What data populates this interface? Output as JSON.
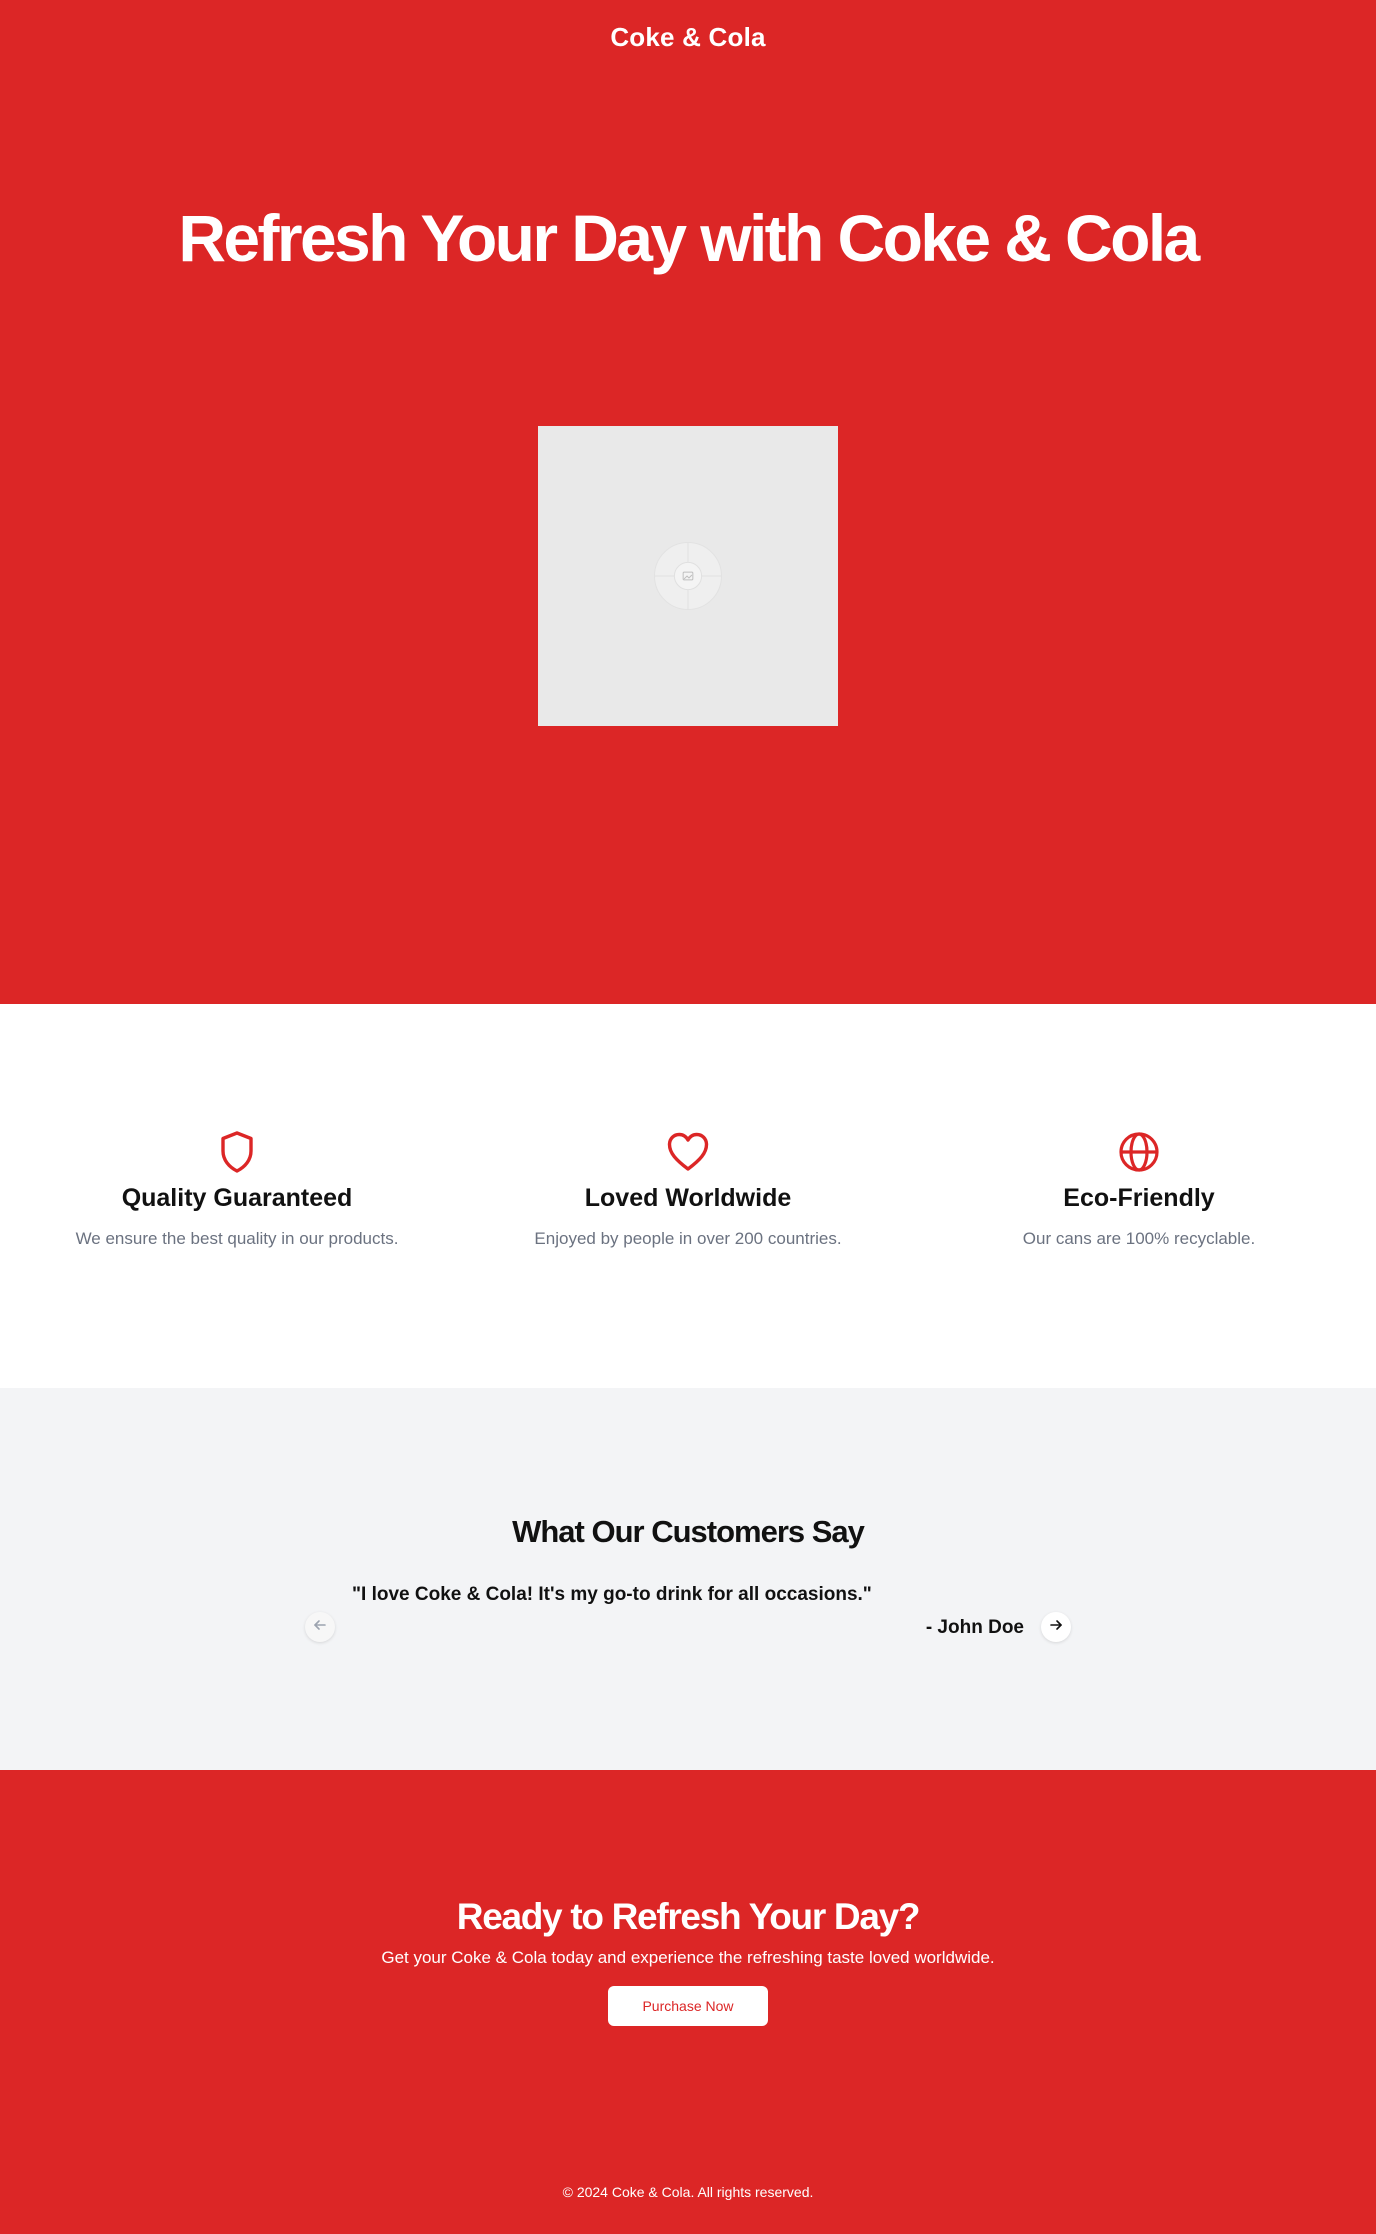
{
  "header": {
    "brand": "Coke & Cola"
  },
  "hero": {
    "title": "Refresh Your Day with Coke & Cola",
    "image_icon": "image-placeholder-icon"
  },
  "features": {
    "items": [
      {
        "icon": "shield-icon",
        "title": "Quality Guaranteed",
        "description": "We ensure the best quality in our products."
      },
      {
        "icon": "heart-icon",
        "title": "Loved Worldwide",
        "description": "Enjoyed by people in over 200 countries."
      },
      {
        "icon": "globe-icon",
        "title": "Eco-Friendly",
        "description": "Our cans are 100% recyclable."
      }
    ]
  },
  "testimonials": {
    "heading": "What Our Customers Say",
    "quote": "\"I love Coke & Cola! It's my go-to drink for all occasions.\"",
    "author": "- John Doe",
    "prev_icon": "arrow-left-icon",
    "next_icon": "arrow-right-icon"
  },
  "cta": {
    "title": "Ready to Refresh Your Day?",
    "subtitle": "Get your Coke & Cola today and experience the refreshing taste loved worldwide.",
    "button_label": "Purchase Now"
  },
  "footer": {
    "copyright": "© 2024 Coke & Cola. All rights reserved."
  },
  "colors": {
    "brand_red": "#dc2626",
    "muted_text": "#6b7280",
    "section_gray": "#f3f4f6"
  }
}
